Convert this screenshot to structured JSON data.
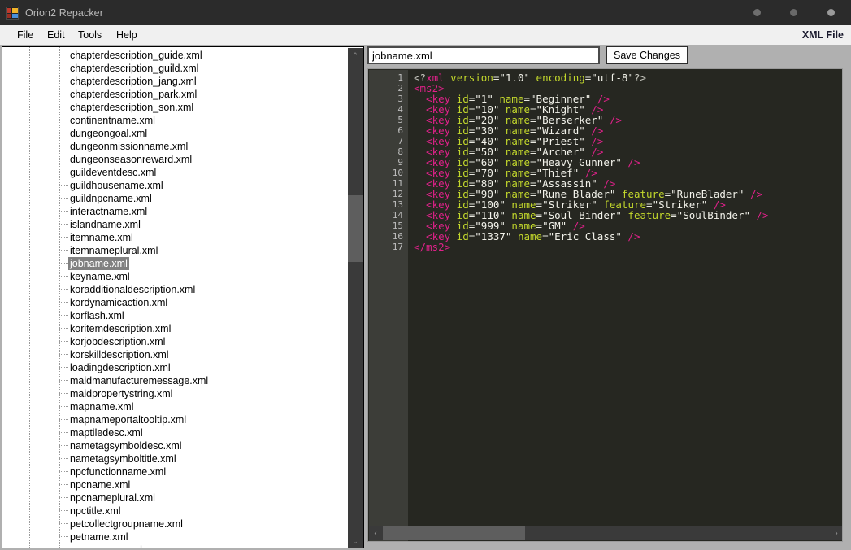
{
  "window": {
    "title": "Orion2 Repacker",
    "icon": "app-icon",
    "controls": {
      "minimize": "minimize-dot",
      "maximize": "maximize-dot",
      "close": "close-dot"
    }
  },
  "menubar": {
    "items": [
      {
        "label": "File"
      },
      {
        "label": "Edit"
      },
      {
        "label": "Tools"
      },
      {
        "label": "Help"
      }
    ],
    "right_label": "XML File"
  },
  "tree": {
    "selected": "jobname.xml",
    "items": [
      "chapterdescription_guide.xml",
      "chapterdescription_guild.xml",
      "chapterdescription_jang.xml",
      "chapterdescription_park.xml",
      "chapterdescription_son.xml",
      "continentname.xml",
      "dungeongoal.xml",
      "dungeonmissionname.xml",
      "dungeonseasonreward.xml",
      "guildeventdesc.xml",
      "guildhousename.xml",
      "guildnpcname.xml",
      "interactname.xml",
      "islandname.xml",
      "itemname.xml",
      "itemnameplural.xml",
      "jobname.xml",
      "keyname.xml",
      "koradditionaldescription.xml",
      "kordynamicaction.xml",
      "korflash.xml",
      "koritemdescription.xml",
      "korjobdescription.xml",
      "korskilldescription.xml",
      "loadingdescription.xml",
      "maidmanufacturemessage.xml",
      "maidpropertystring.xml",
      "mapname.xml",
      "mapnameportaltooltip.xml",
      "maptiledesc.xml",
      "nametagsymboldesc.xml",
      "nametagsymboltitle.xml",
      "npcfunctionname.xml",
      "npcname.xml",
      "npcnameplural.xml",
      "npctitle.xml",
      "petcollectgroupname.xml",
      "petname.xml",
      "popupmenu.xml"
    ],
    "scrollbar": {
      "up_arrow": "⌃",
      "down_arrow": "⌄"
    }
  },
  "editor": {
    "filename_value": "jobname.xml",
    "filename_placeholder": "",
    "save_button": "Save Changes",
    "hscroll": {
      "left_arrow": "‹",
      "right_arrow": "›"
    },
    "line_numbers": [
      1,
      2,
      3,
      4,
      5,
      6,
      7,
      8,
      9,
      10,
      11,
      12,
      13,
      14,
      15,
      16,
      17
    ],
    "lines": [
      {
        "indent": 0,
        "type": "decl",
        "text": "<?xml version=\"1.0\" encoding=\"utf-8\"?>"
      },
      {
        "indent": 0,
        "type": "open",
        "tag": "ms2"
      },
      {
        "indent": 1,
        "type": "selfclose",
        "tag": "key",
        "attrs": [
          {
            "name": "id",
            "value": "1"
          },
          {
            "name": "name",
            "value": "Beginner"
          }
        ]
      },
      {
        "indent": 1,
        "type": "selfclose",
        "tag": "key",
        "attrs": [
          {
            "name": "id",
            "value": "10"
          },
          {
            "name": "name",
            "value": "Knight"
          }
        ]
      },
      {
        "indent": 1,
        "type": "selfclose",
        "tag": "key",
        "attrs": [
          {
            "name": "id",
            "value": "20"
          },
          {
            "name": "name",
            "value": "Berserker"
          }
        ]
      },
      {
        "indent": 1,
        "type": "selfclose",
        "tag": "key",
        "attrs": [
          {
            "name": "id",
            "value": "30"
          },
          {
            "name": "name",
            "value": "Wizard"
          }
        ]
      },
      {
        "indent": 1,
        "type": "selfclose",
        "tag": "key",
        "attrs": [
          {
            "name": "id",
            "value": "40"
          },
          {
            "name": "name",
            "value": "Priest"
          }
        ]
      },
      {
        "indent": 1,
        "type": "selfclose",
        "tag": "key",
        "attrs": [
          {
            "name": "id",
            "value": "50"
          },
          {
            "name": "name",
            "value": "Archer"
          }
        ]
      },
      {
        "indent": 1,
        "type": "selfclose",
        "tag": "key",
        "attrs": [
          {
            "name": "id",
            "value": "60"
          },
          {
            "name": "name",
            "value": "Heavy Gunner"
          }
        ]
      },
      {
        "indent": 1,
        "type": "selfclose",
        "tag": "key",
        "attrs": [
          {
            "name": "id",
            "value": "70"
          },
          {
            "name": "name",
            "value": "Thief"
          }
        ]
      },
      {
        "indent": 1,
        "type": "selfclose",
        "tag": "key",
        "attrs": [
          {
            "name": "id",
            "value": "80"
          },
          {
            "name": "name",
            "value": "Assassin"
          }
        ]
      },
      {
        "indent": 1,
        "type": "selfclose",
        "tag": "key",
        "attrs": [
          {
            "name": "id",
            "value": "90"
          },
          {
            "name": "name",
            "value": "Rune Blader"
          },
          {
            "name": "feature",
            "value": "RuneBlader"
          }
        ]
      },
      {
        "indent": 1,
        "type": "selfclose",
        "tag": "key",
        "attrs": [
          {
            "name": "id",
            "value": "100"
          },
          {
            "name": "name",
            "value": "Striker"
          },
          {
            "name": "feature",
            "value": "Striker"
          }
        ]
      },
      {
        "indent": 1,
        "type": "selfclose",
        "tag": "key",
        "attrs": [
          {
            "name": "id",
            "value": "110"
          },
          {
            "name": "name",
            "value": "Soul Binder"
          },
          {
            "name": "feature",
            "value": "SoulBinder"
          }
        ]
      },
      {
        "indent": 1,
        "type": "selfclose",
        "tag": "key",
        "attrs": [
          {
            "name": "id",
            "value": "999"
          },
          {
            "name": "name",
            "value": "GM"
          }
        ]
      },
      {
        "indent": 1,
        "type": "selfclose",
        "tag": "key",
        "attrs": [
          {
            "name": "id",
            "value": "1337"
          },
          {
            "name": "name",
            "value": "Eric Class"
          }
        ]
      },
      {
        "indent": 0,
        "type": "close",
        "tag": "ms2"
      }
    ]
  },
  "colors": {
    "titlebar_bg": "#2b2b2b",
    "menubar_bg": "#f0f0f0",
    "panel_bg": "#b0b0b0",
    "editor_bg": "#262721",
    "gutter_bg": "#3c3d38",
    "tag": "#e0218a",
    "attr": "#c3d82c",
    "value": "#f2f2ea",
    "selection": "#808080"
  }
}
